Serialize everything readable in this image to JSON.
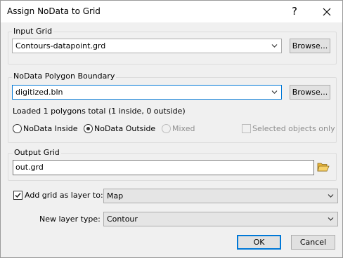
{
  "window": {
    "title": "Assign NoData to Grid",
    "help_label": "?",
    "close_label": "✕"
  },
  "input_grid": {
    "label": "Input Grid",
    "value": "Contours-datapoint.grd",
    "browse_label": "Browse..."
  },
  "polygon": {
    "label": "NoData Polygon Boundary",
    "value": "digitized.bln",
    "browse_label": "Browse...",
    "status": "Loaded 1 polygons total (1 inside, 0 outside)",
    "options": {
      "inside": "NoData Inside",
      "outside": "NoData Outside",
      "mixed": "Mixed",
      "selected_only": "Selected objects only"
    },
    "selected_option": "outside"
  },
  "output_grid": {
    "label": "Output Grid",
    "value": "out.grd"
  },
  "add_layer": {
    "label": "Add grid as layer to:",
    "checked": true,
    "value": "Map"
  },
  "layer_type": {
    "label": "New layer type:",
    "value": "Contour"
  },
  "buttons": {
    "ok": "OK",
    "cancel": "Cancel"
  },
  "colors": {
    "accent": "#0078d7",
    "folder": "#e8b53a"
  }
}
